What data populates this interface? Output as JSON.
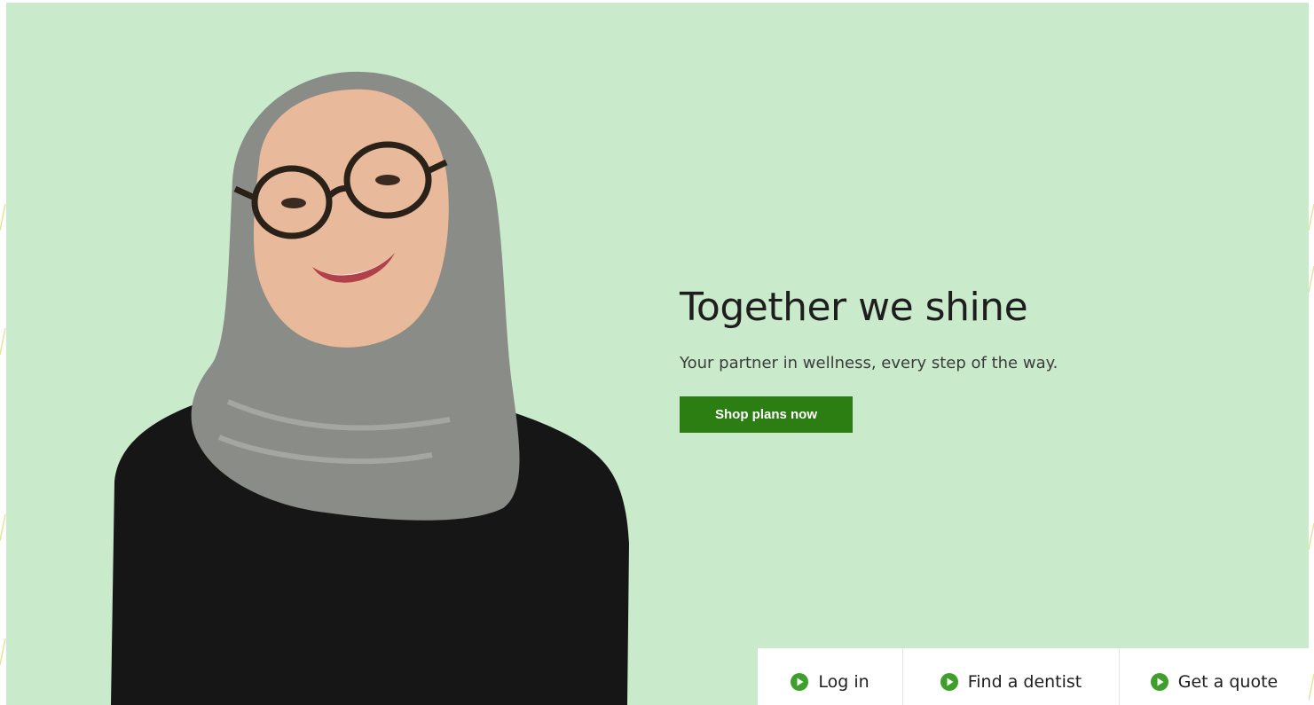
{
  "colors": {
    "hero_background": "#caebcb",
    "accent_green": "#2c7d12",
    "icon_green": "#3ea02a",
    "edge_line_yellow": "#e6e2a0",
    "headscarf": "#8a8c88",
    "sweater": "#161616",
    "skin": "#e8b99a"
  },
  "hero": {
    "image_icon": "woman-portrait-image",
    "title": "Together we shine",
    "subtitle": "Your partner in wellness, every step of the way.",
    "cta_label": "Shop plans now"
  },
  "quick_links": [
    {
      "label": "Log in",
      "icon": "play-circle-icon"
    },
    {
      "label": "Find a dentist",
      "icon": "play-circle-icon"
    },
    {
      "label": "Get a quote",
      "icon": "play-circle-icon"
    }
  ]
}
